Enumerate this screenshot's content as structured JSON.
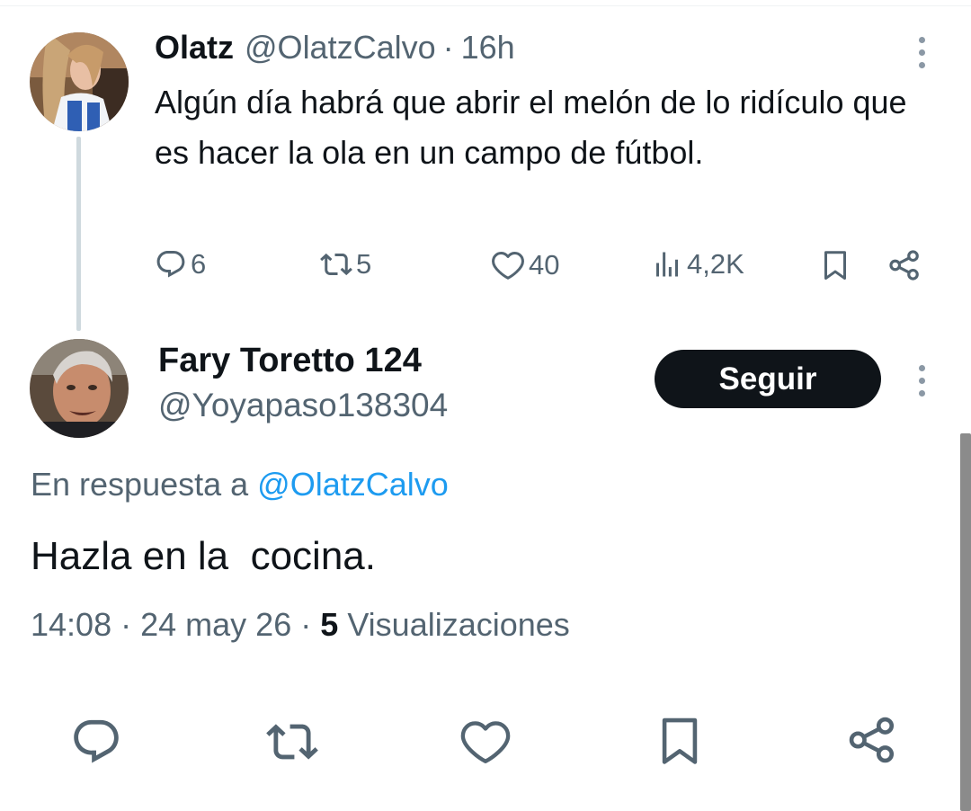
{
  "thread": {
    "parent": {
      "name": "Olatz",
      "handle": "@OlatzCalvo",
      "separator": "·",
      "time": "16h",
      "text": "Algún día habrá que abrir el melón de lo ridículo que es hacer la ola en un campo de fútbol.",
      "actions": {
        "replies": "6",
        "reposts": "5",
        "likes": "40",
        "views": "4,2K"
      }
    },
    "reply": {
      "name": "Fary Toretto 124",
      "handle": "@Yoyapaso138304",
      "follow_label": "Seguir",
      "reply_prefix": "En respuesta a",
      "reply_mention": "@OlatzCalvo",
      "text": "Hazla en la  cocina.",
      "time": "14:08",
      "separator": "·",
      "date": "24 may 26",
      "views_count": "5",
      "views_label": "Visualizaciones"
    }
  },
  "icons": {
    "reply": "reply-icon",
    "repost": "repost-icon",
    "like": "heart-icon",
    "views": "views-bar-icon",
    "bookmark": "bookmark-icon",
    "share": "share-icon",
    "more": "more-vertical-icon"
  },
  "colors": {
    "text": "#0f1419",
    "secondary": "#536471",
    "link": "#1d9bf0",
    "button_bg": "#0f1419",
    "thread_line": "#cfd9de"
  }
}
